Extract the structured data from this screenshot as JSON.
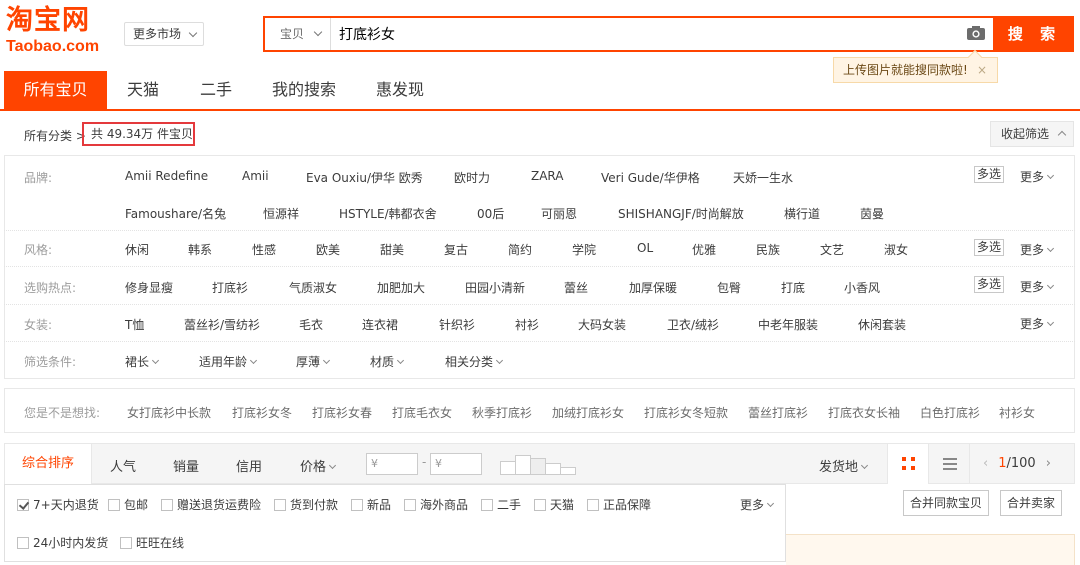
{
  "header": {
    "logo_cn": "淘宝网",
    "logo_en": "Taobao.com",
    "market_label": "更多市场",
    "search_type": "宝贝",
    "search_value": "打底衫女",
    "search_button": "搜 索",
    "tip": "上传图片就能搜同款啦!",
    "tip_close": "×"
  },
  "tabs": [
    "所有宝贝",
    "天猫",
    "二手",
    "我的搜索",
    "惠发现"
  ],
  "crumb": {
    "all": "所有分类",
    "total": "共 49.34万 件宝贝",
    "collapse": "收起筛选"
  },
  "filters": {
    "brand_label": "品牌:",
    "brands_row1": [
      "Amii Redefine",
      "Amii",
      "Eva Ouxiu/伊华 欧秀",
      "欧时力",
      "ZARA",
      "Veri Gude/华伊格",
      "天娇一生水"
    ],
    "brands_row2": [
      "Famoushare/名兔",
      "恒源祥",
      "HSTYLE/韩都衣舍",
      "00后",
      "可丽恩",
      "SHISHANGJF/时尚解放",
      "横行道",
      "茵曼"
    ],
    "style_label": "风格:",
    "styles": [
      "休闲",
      "韩系",
      "性感",
      "欧美",
      "甜美",
      "复古",
      "简约",
      "学院",
      "OL",
      "优雅",
      "民族",
      "文艺",
      "淑女"
    ],
    "hot_label": "选购热点:",
    "hots": [
      "修身显瘦",
      "打底衫",
      "气质淑女",
      "加肥加大",
      "田园小清新",
      "蕾丝",
      "加厚保暖",
      "包臀",
      "打底",
      "小香风"
    ],
    "women_label": "女装:",
    "women": [
      "T恤",
      "蕾丝衫/雪纺衫",
      "毛衣",
      "连衣裙",
      "针织衫",
      "衬衫",
      "大码女装",
      "卫衣/绒衫",
      "中老年服装",
      "休闲套装"
    ],
    "cond_label": "筛选条件:",
    "conds": [
      "裙长",
      "适用年龄",
      "厚薄",
      "材质",
      "相关分类"
    ],
    "multi": "多选",
    "more": "更多"
  },
  "suggest": {
    "label": "您是不是想找:",
    "items": [
      "女打底衫中长款",
      "打底衫女冬",
      "打底衫女春",
      "打底毛衣女",
      "秋季打底衫",
      "加绒打底衫女",
      "打底衫女冬短款",
      "蕾丝打底衫",
      "打底衣女长袖",
      "白色打底衫",
      "衬衫女"
    ]
  },
  "sort": {
    "items": [
      "综合排序",
      "人气",
      "销量",
      "信用",
      "价格"
    ],
    "price_from": "¥",
    "price_to": "¥",
    "dash": "-",
    "ship_from": "发货地",
    "page_current": "1",
    "page_total": "/100"
  },
  "options": {
    "row1": [
      "7+天内退货",
      "包邮",
      "赠送退货运费险",
      "货到付款",
      "新品",
      "海外商品",
      "二手",
      "天猫",
      "正品保障"
    ],
    "row2": [
      "24小时内发货",
      "旺旺在线"
    ],
    "checked_first": true,
    "more": "更多",
    "merge_same": "合并同款宝贝",
    "merge_seller": "合并卖家"
  },
  "colors": {
    "accent": "#ff4400",
    "highlight_box": "#e4393c"
  }
}
